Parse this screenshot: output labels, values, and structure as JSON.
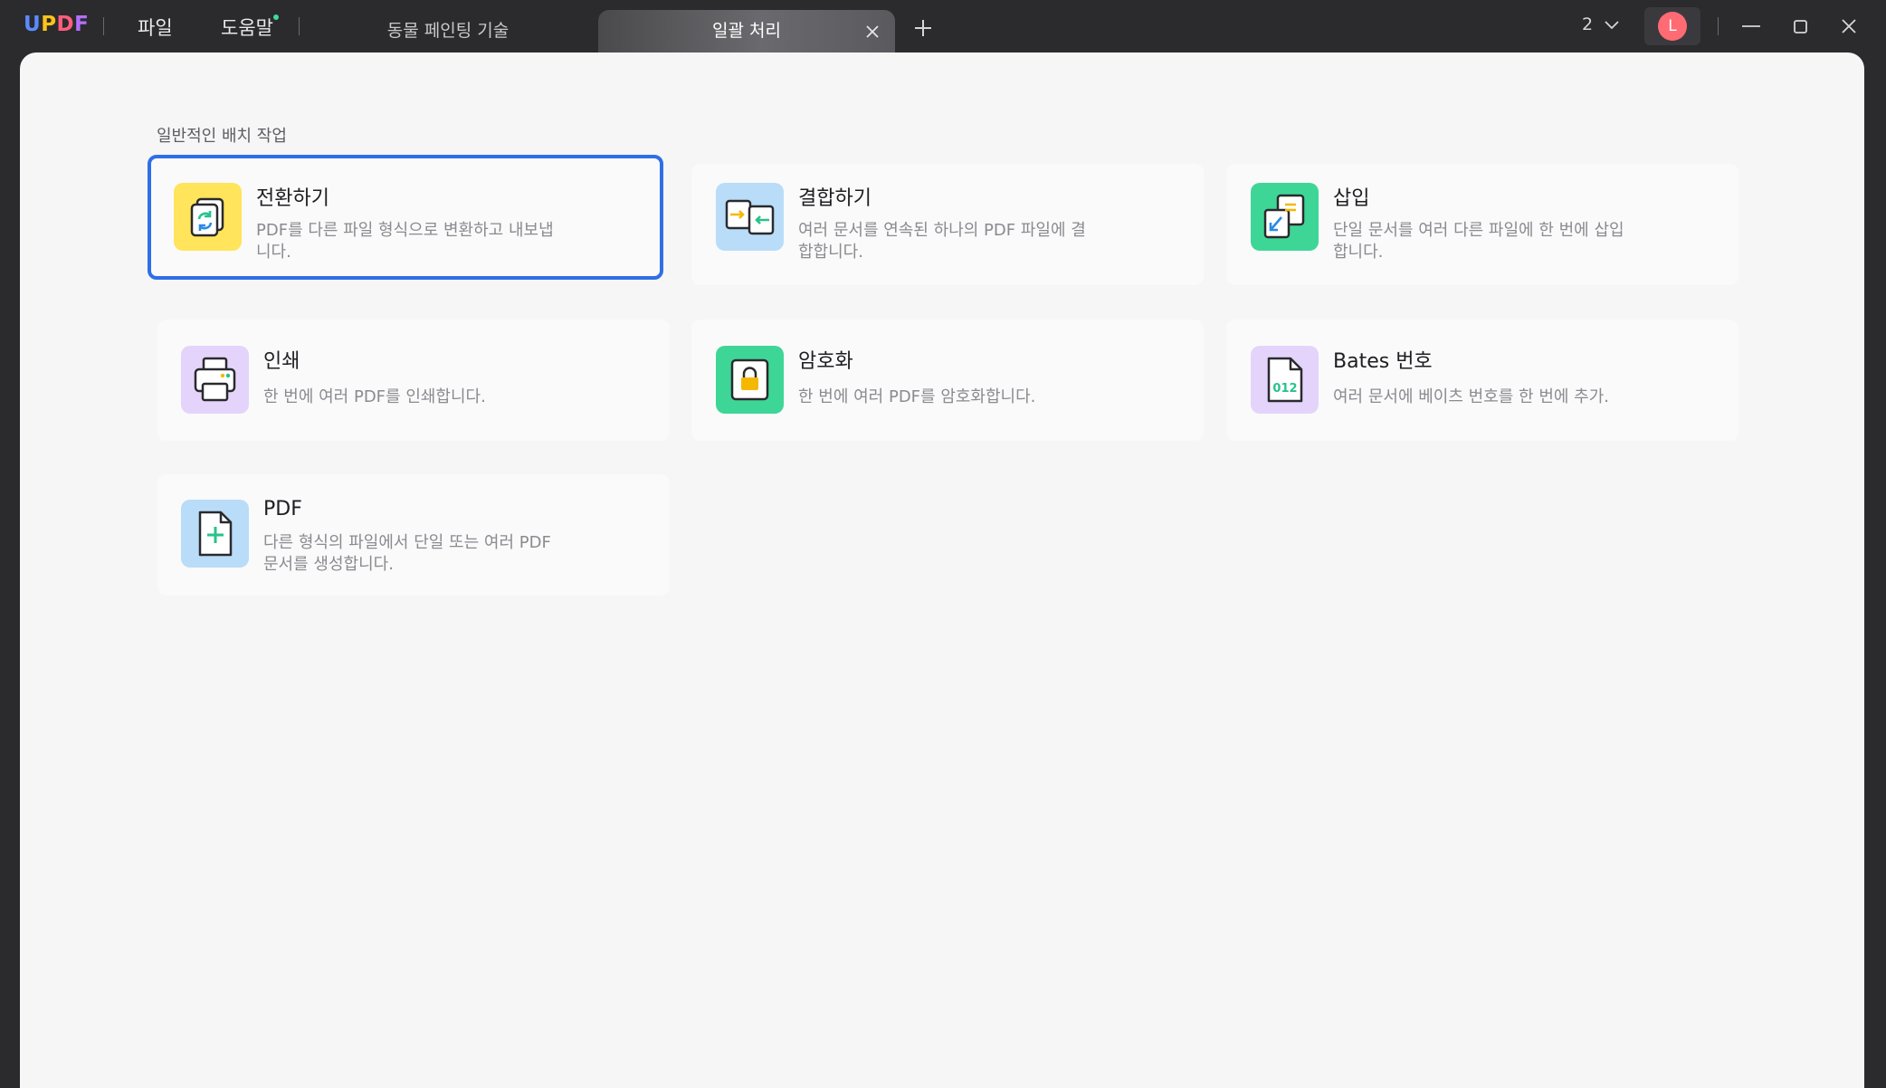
{
  "app": {
    "logo": [
      "U",
      "P",
      "D",
      "F"
    ]
  },
  "menu": {
    "file": "파일",
    "help": "도움말"
  },
  "tabs": [
    {
      "label": "동물 페인팅 기술"
    },
    {
      "label": "일괄 처리"
    }
  ],
  "window": {
    "count": "2",
    "avatar_initial": "L"
  },
  "section": {
    "title": "일반적인 배치 작업"
  },
  "cards": [
    {
      "title": "전환하기",
      "desc": "PDF를 다른 파일 형식으로 변환하고 내보냅니다."
    },
    {
      "title": "결합하기",
      "desc": "여러 문서를 연속된 하나의 PDF 파일에 결합합니다."
    },
    {
      "title": "삽입",
      "desc": "단일 문서를 여러 다른 파일에 한 번에 삽입합니다."
    },
    {
      "title": "인쇄",
      "desc": "한 번에 여러 PDF를 인쇄합니다."
    },
    {
      "title": "암호화",
      "desc": "한 번에 여러 PDF를 암호화합니다."
    },
    {
      "title": "Bates 번호",
      "desc": "여러 문서에 베이츠 번호를 한 번에 추가.",
      "icon_text": "012"
    },
    {
      "title": "PDF",
      "desc": "다른 형식의 파일에서 단일 또는 여러 PDF 문서를 생성합니다."
    }
  ],
  "colors": {
    "accent": "#2f6fe6",
    "convert": "#ffe45c",
    "combine": "#b9dcf8",
    "insert": "#3ed696",
    "print": "#e4d4fb",
    "encrypt": "#3ed696",
    "bates": "#e4d4fb",
    "create": "#b9dcf8"
  },
  "icons": [
    "convert-icon",
    "combine-icon",
    "insert-icon",
    "printer-icon",
    "lock-icon",
    "bates-number-icon",
    "add-document-icon"
  ]
}
